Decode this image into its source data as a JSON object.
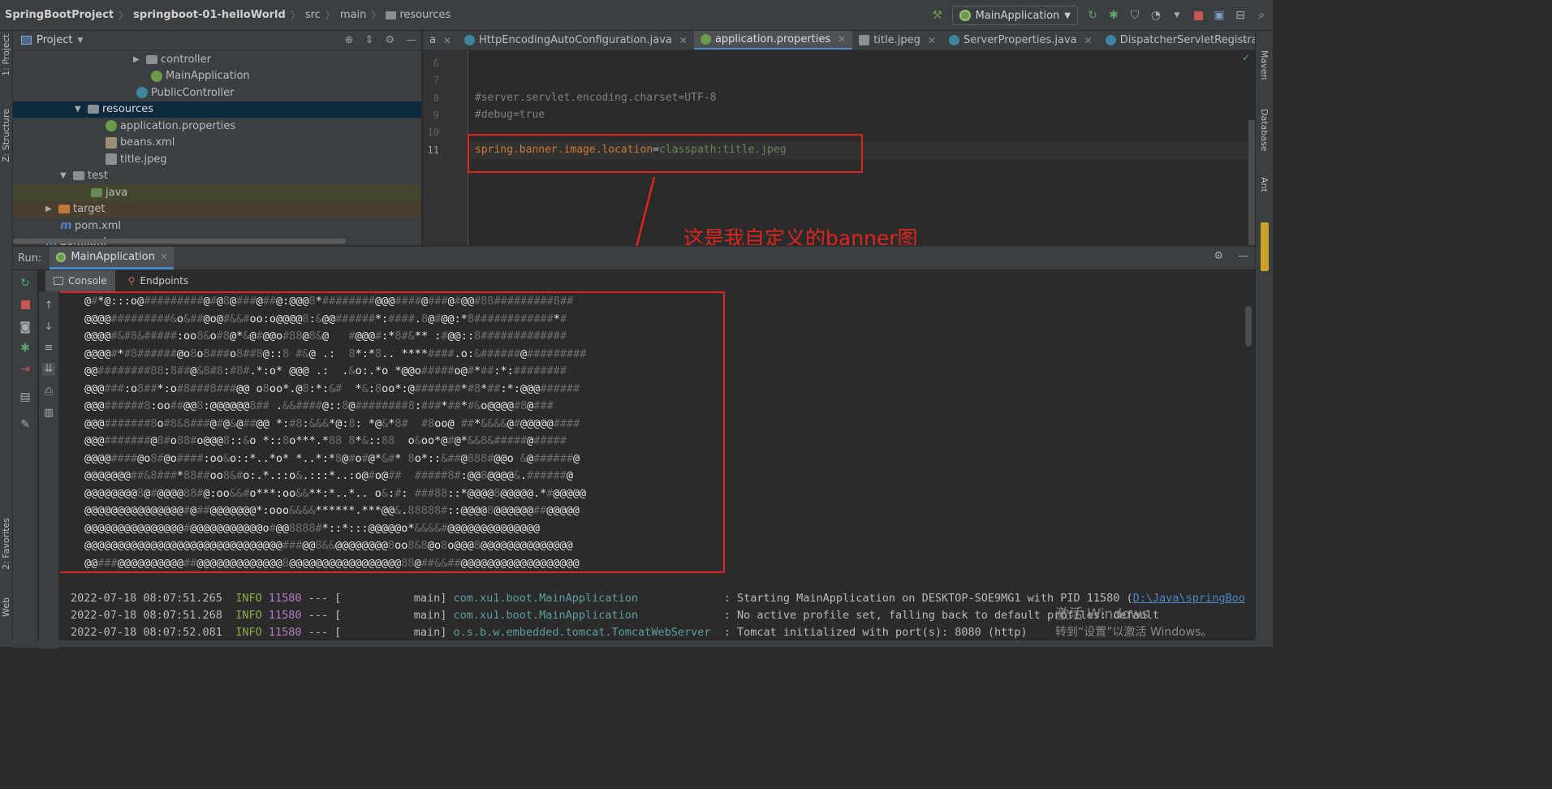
{
  "breadcrumb": [
    "SpringBootProject",
    "springboot-01-helloWorld",
    "src",
    "main",
    "resources"
  ],
  "run_config": "MainApplication",
  "left_strip": {
    "project": "1: Project",
    "structure": "Z: Structure",
    "favorites": "2: Favorites",
    "web": "Web"
  },
  "right_strip": {
    "maven": "Maven",
    "database": "Database",
    "ant": "Ant"
  },
  "project_panel": {
    "title": "Project",
    "tree": [
      {
        "label": "controller",
        "icon": "folder-icon"
      },
      {
        "label": "MainApplication",
        "icon": "spring-class-icon"
      },
      {
        "label": "PublicController",
        "icon": "class-icon"
      },
      {
        "label": "resources",
        "icon": "resources-folder-icon"
      },
      {
        "label": "application.properties",
        "icon": "properties-icon"
      },
      {
        "label": "beans.xml",
        "icon": "xml-icon"
      },
      {
        "label": "title.jpeg",
        "icon": "image-icon"
      },
      {
        "label": "test",
        "icon": "folder-icon"
      },
      {
        "label": "java",
        "icon": "source-folder-icon"
      },
      {
        "label": "target",
        "icon": "excluded-folder-icon"
      },
      {
        "label": "pom.xml",
        "icon": "maven-icon"
      },
      {
        "label": "pom.xml",
        "icon": "maven-icon"
      }
    ]
  },
  "editor": {
    "tabs": [
      {
        "label": "a"
      },
      {
        "label": "HttpEncodingAutoConfiguration.java"
      },
      {
        "label": "application.properties"
      },
      {
        "label": "title.jpeg"
      },
      {
        "label": "ServerProperties.java"
      },
      {
        "label": "DispatcherServletRegistrationBea"
      }
    ],
    "lines": [
      {
        "num": "6",
        "text": ""
      },
      {
        "num": "7",
        "text": ""
      },
      {
        "num": "8",
        "text": "#server.servlet.encoding.charset=UTF-8"
      },
      {
        "num": "9",
        "text": "#debug=true"
      },
      {
        "num": "10",
        "text": ""
      },
      {
        "num": "11",
        "key": "spring.banner.image.location",
        "eq": "=",
        "val": "classpath:title.jpeg"
      }
    ],
    "annotation": "这是我自定义的banner图"
  },
  "run_panel": {
    "label": "Run:",
    "tab": "MainApplication",
    "console_tab": "Console",
    "endpoints_tab": "Endpoints"
  },
  "banner_lines": [
    "@#*@:::o@#########@#@8@###@##@:@@@8*########@@@####@###@#@@#88#########8##",
    "@@@@#########&o&##@o@#&&#oo:o@@@@8:&@@######*:####.8@#@@:*8############*#",
    "@@@@#&#8&#####:oo8&o#8@*&@#@@o#88@8&@   #@@@#:*8#&** :#@@::8#############",
    "@@@@#*#8######@o8o8###o8##8@::8 #&@ .:  8*:*8.. ****####.o:&######@#########",
    "@@########88:8##@&8#8:#8#.*:o* @@@ .:  .&o:.*o *@@o#####o@#*##:*:########",
    "@@@###:o8##*:o#8###8###@@ o8oo*.@8:*:&#  *&:8oo*:@#######*#8*##:*:@@@######",
    "@@@######8:oo##@@8:@@@@@@8## .&&####@::8@########8:###*##*#&o@@@@#8@###",
    "@@@#######8o#8&8###@#@&@##@@ *:#8:&&&*@:8: *@&*8#  #8oo@ ##*&&&&@#@@@@@####",
    "@@@#######@8#o88#o@@@8::&o *::8o***.*88 8*&::88  o&oo*@#@*&&8&#####@#####",
    "@@@@####@o8#@o####:oo&o::*..*o* *..*:*8@#o#@*&#* 8o*::&##@888#@@o &@######@",
    "@@@@@@@##&8###*88##oo8&#o:.*.::o&.:::*..:o@#o@##  #####8#:@@8@@@@&.######@",
    "@@@@@@@@8@#@@@@88#@:oo&&#o***:oo&&**:*..*.. o&:#: ###88::*@@@@8@@@@@.*#@@@@@",
    "@@@@@@@@@@@@@@@#@##@@@@@@@*:ooo&&&&******.***@@&.88888#::@@@@8@@@@@@##@@@@@",
    "@@@@@@@@@@@@@@@#@@@@@@@@@@@o#@@8888#*::*:::@@@@@o*&&&&#@@@@@@@@@@@@@@",
    "@@@@@@@@@@@@@@@@@@@@@@@@@@@@@@###@@8&&@@@@@@@@8oo8&8@o8o@@@8@@@@@@@@@@@@@@",
    "@@###@@@@@@@@@@##@@@@@@@@@@@@@8@@@@@@@@@@@@@@@@@88@##&&##@@@@@@@@@@@@@@@@@@"
  ],
  "logs": [
    {
      "ts": "2022-07-18 08:07:51.265",
      "level": "INFO",
      "pid": "11580",
      "sep": "---",
      "thread": "main",
      "cls": "com.xu1.boot.MainApplication",
      "msg": ": Starting MainApplication on DESKTOP-SOE9MG1 with PID 11580 (",
      "link": "D:\\Java\\springBoo"
    },
    {
      "ts": "2022-07-18 08:07:51.268",
      "level": "INFO",
      "pid": "11580",
      "sep": "---",
      "thread": "main",
      "cls": "com.xu1.boot.MainApplication",
      "msg": ": No active profile set, falling back to default profiles: default",
      "link": ""
    },
    {
      "ts": "2022-07-18 08:07:52.081",
      "level": "INFO",
      "pid": "11580",
      "sep": "---",
      "thread": "main",
      "cls": "o.s.b.w.embedded.tomcat.TomcatWebServer",
      "msg": ": Tomcat initialized with port(s): 8080 (http)",
      "link": ""
    }
  ],
  "watermark": {
    "line1": "激活 Windows",
    "line2": "转到“设置”以激活 Windows。"
  }
}
